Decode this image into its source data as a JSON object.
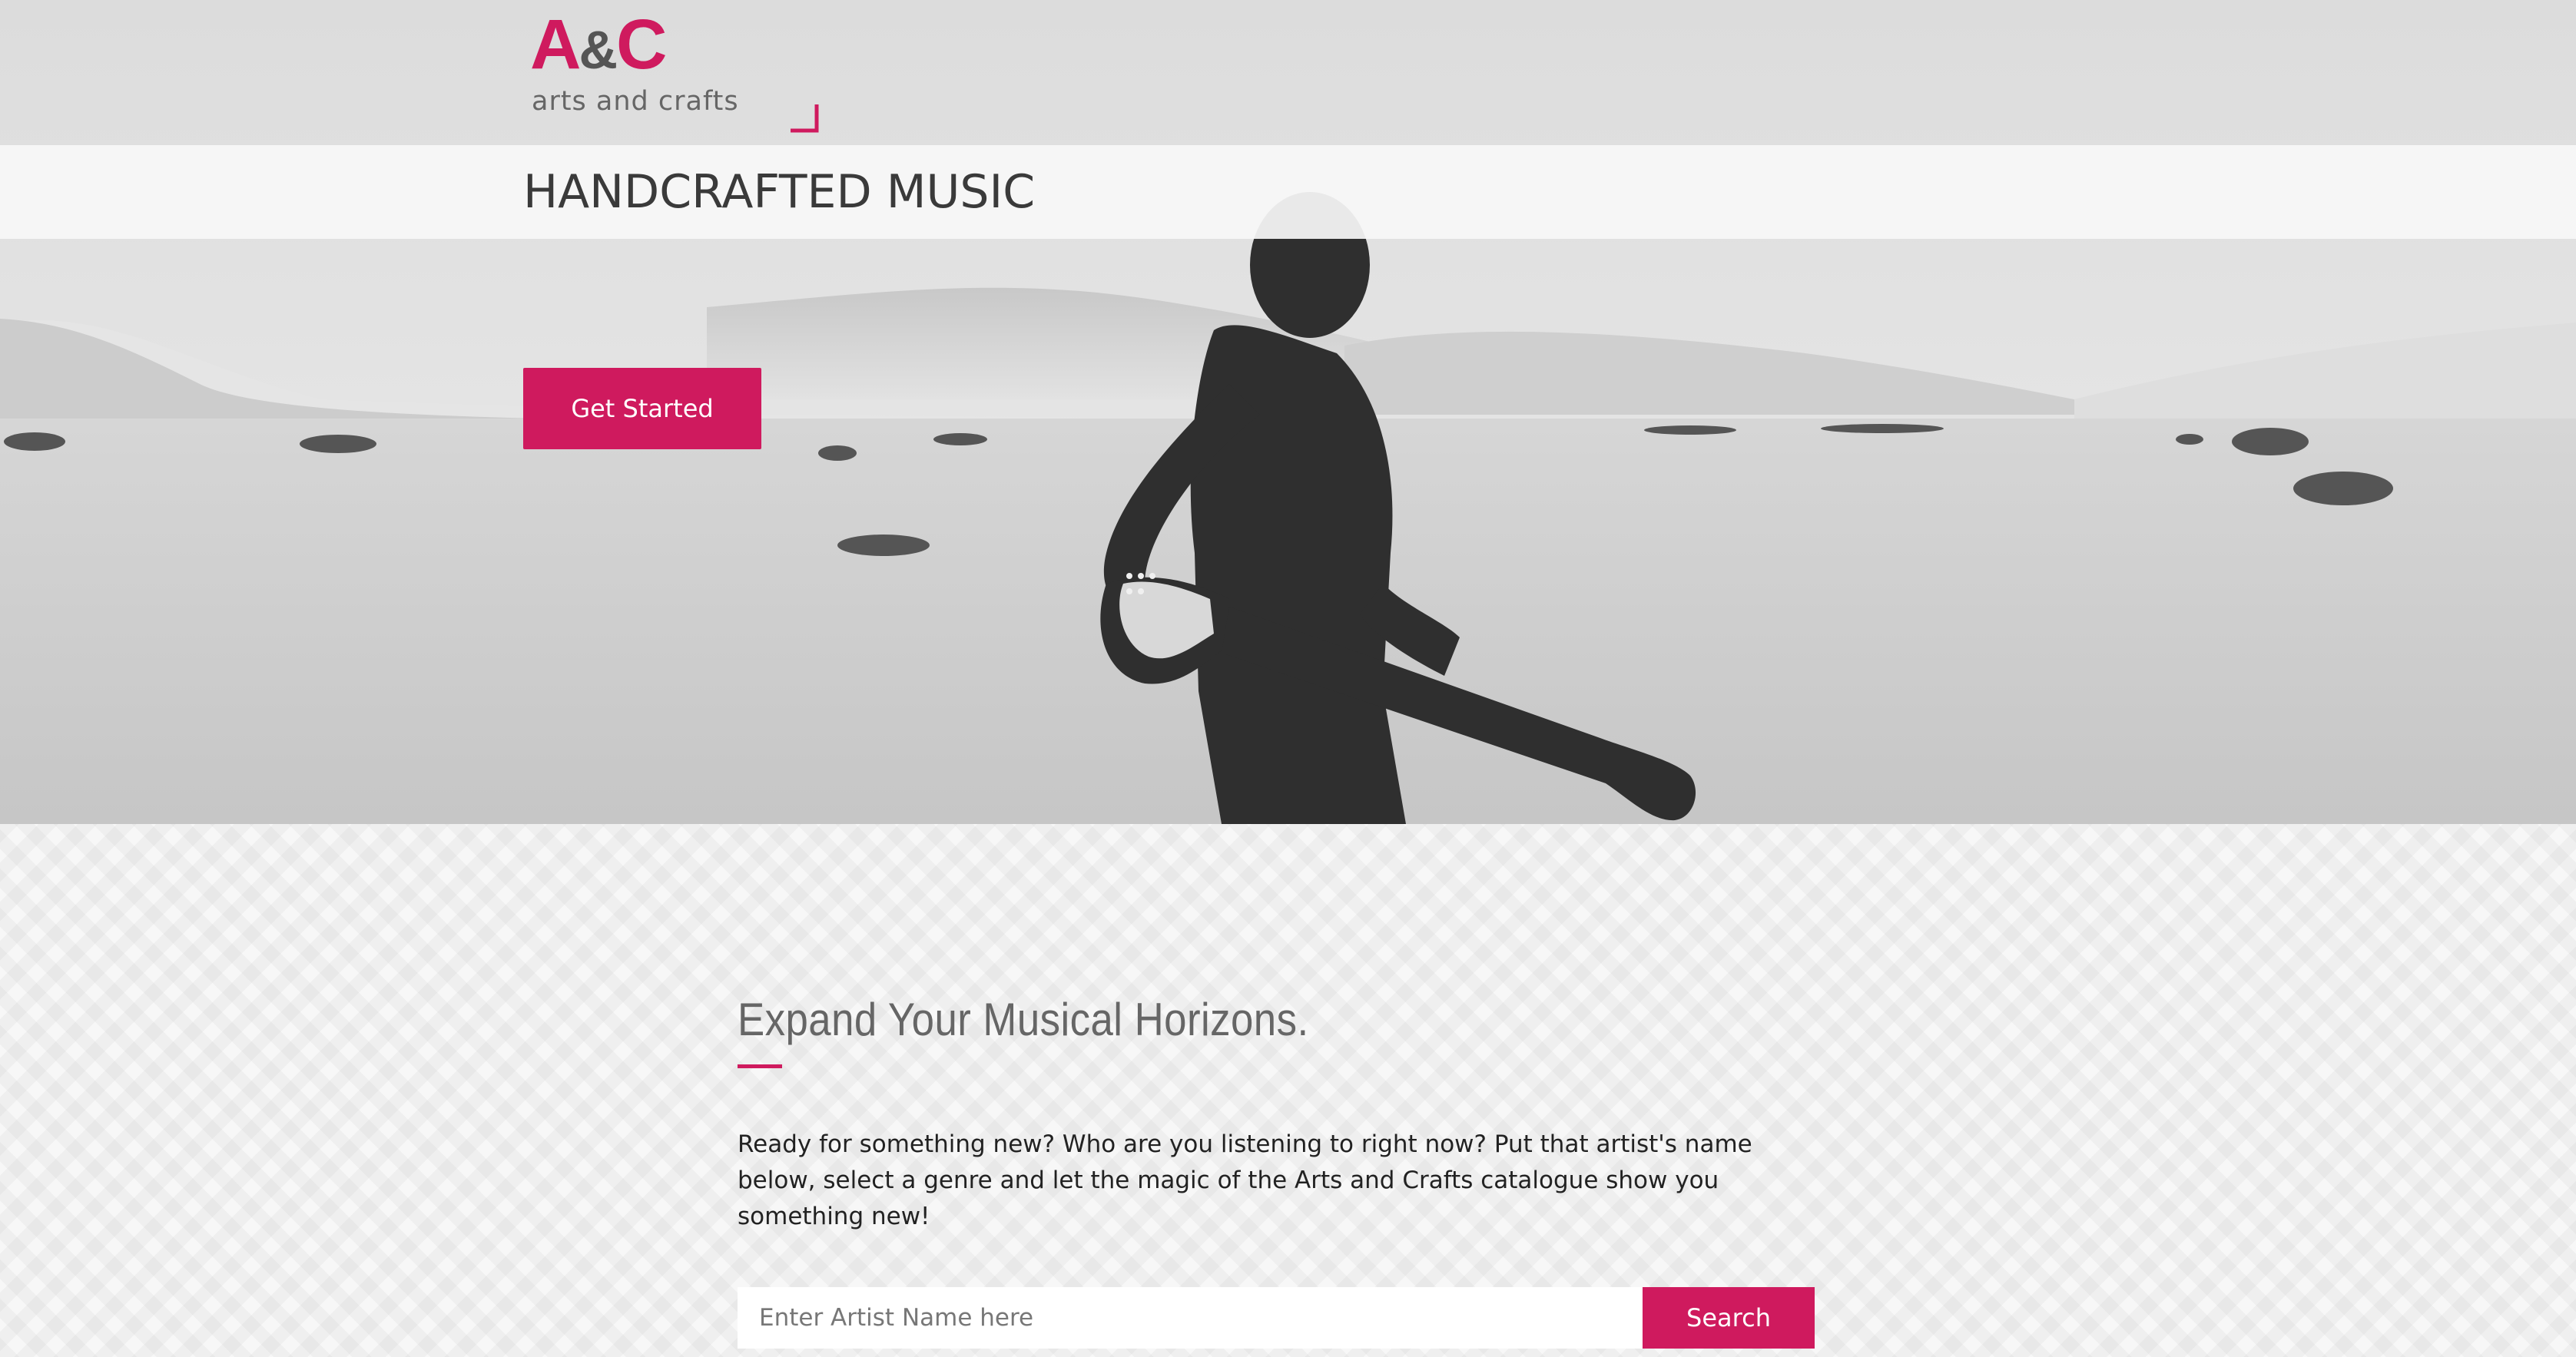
{
  "brand": {
    "logo_a": "A",
    "logo_amp": "&",
    "logo_c": "C",
    "tagline": "arts and crafts",
    "accent_color": "#cf1a5e"
  },
  "hero": {
    "title": "HANDCRAFTED MUSIC",
    "cta_label": "Get Started",
    "image": "black-and-white desert photo with a silhouetted person carrying a bass guitar"
  },
  "discover": {
    "heading": "Expand Your Musical Horizons.",
    "description": "Ready for something new? Who are you listening to right now? Put that artist's name below, select a genre and let the magic of the Arts and Crafts catalogue show you something new!",
    "search": {
      "placeholder": "Enter Artist Name here",
      "value": "",
      "button_label": "Search"
    }
  }
}
